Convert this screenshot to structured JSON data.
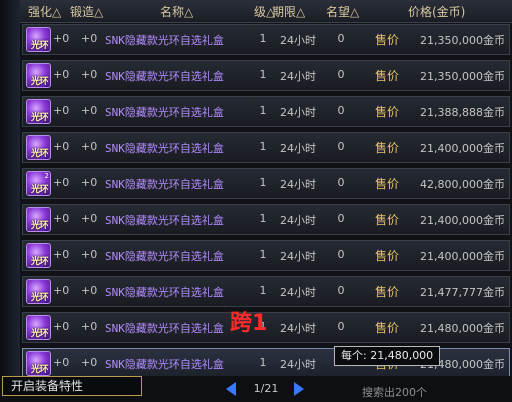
{
  "header": {
    "strength": "强化△",
    "forge": "锻造△",
    "name": "名称△",
    "level": "级△",
    "duration": "期限△",
    "fame": "名望△",
    "price": "价格(金币)"
  },
  "rows": [
    {
      "icon_text": "光环",
      "count": "",
      "strength": "+0",
      "forge": "+0",
      "name": "SNK隐藏款光环自选礼盒",
      "level": "1",
      "duration": "24小时",
      "fame": "0",
      "sell": "售价",
      "price": "21,350,000金币"
    },
    {
      "icon_text": "光环",
      "count": "",
      "strength": "+0",
      "forge": "+0",
      "name": "SNK隐藏款光环自选礼盒",
      "level": "1",
      "duration": "24小时",
      "fame": "0",
      "sell": "售价",
      "price": "21,350,000金币"
    },
    {
      "icon_text": "光环",
      "count": "",
      "strength": "+0",
      "forge": "+0",
      "name": "SNK隐藏款光环自选礼盒",
      "level": "1",
      "duration": "24小时",
      "fame": "0",
      "sell": "售价",
      "price": "21,388,888金币"
    },
    {
      "icon_text": "光环",
      "count": "",
      "strength": "+0",
      "forge": "+0",
      "name": "SNK隐藏款光环自选礼盒",
      "level": "1",
      "duration": "24小时",
      "fame": "0",
      "sell": "售价",
      "price": "21,400,000金币"
    },
    {
      "icon_text": "光环",
      "count": "2",
      "strength": "+0",
      "forge": "+0",
      "name": "SNK隐藏款光环自选礼盒",
      "level": "1",
      "duration": "24小时",
      "fame": "0",
      "sell": "售价",
      "price": "42,800,000金币"
    },
    {
      "icon_text": "光环",
      "count": "",
      "strength": "+0",
      "forge": "+0",
      "name": "SNK隐藏款光环自选礼盒",
      "level": "1",
      "duration": "24小时",
      "fame": "0",
      "sell": "售价",
      "price": "21,400,000金币"
    },
    {
      "icon_text": "光环",
      "count": "",
      "strength": "+0",
      "forge": "+0",
      "name": "SNK隐藏款光环自选礼盒",
      "level": "1",
      "duration": "24小时",
      "fame": "0",
      "sell": "售价",
      "price": "21,400,000金币"
    },
    {
      "icon_text": "光环",
      "count": "",
      "strength": "+0",
      "forge": "+0",
      "name": "SNK隐藏款光环自选礼盒",
      "level": "1",
      "duration": "24小时",
      "fame": "0",
      "sell": "售价",
      "price": "21,477,777金币"
    },
    {
      "icon_text": "光环",
      "count": "",
      "strength": "+0",
      "forge": "+0",
      "name": "SNK隐藏款光环自选礼盒",
      "level": "1",
      "duration": "24小时",
      "fame": "0",
      "sell": "售价",
      "price": "21,480,000金币"
    },
    {
      "icon_text": "光环",
      "count": "",
      "strength": "+0",
      "forge": "+0",
      "name": "SNK隐藏款光环自选礼盒",
      "level": "1",
      "duration": "24小时",
      "fame": "0",
      "sell": "售价",
      "price": "21,480,000金币"
    }
  ],
  "annotation": "跨1",
  "tooltip": "每个: 21,480,000",
  "footer": {
    "feature_button": "开启装备特性",
    "page": "1/21",
    "search_count": "搜索出200个"
  },
  "colors": {
    "item_name": "#b28cff",
    "sell_label": "#e6c468",
    "annotation": "#ff2a2a",
    "pager_arrow": "#3a78ff"
  },
  "icons": {
    "item": "aura-box-icon",
    "prev": "arrow-left-icon",
    "next": "arrow-right-icon"
  }
}
